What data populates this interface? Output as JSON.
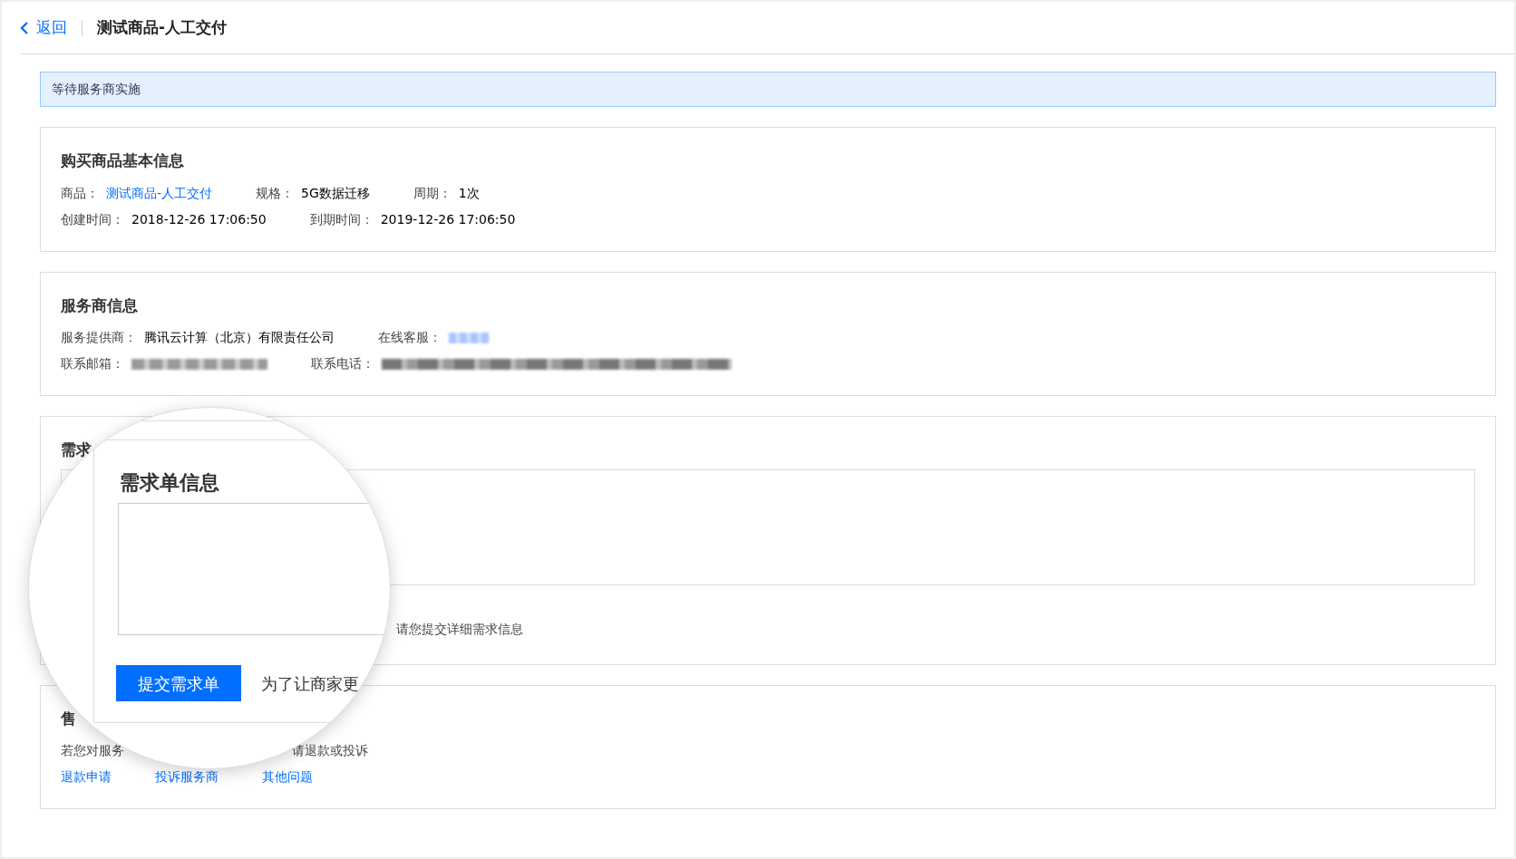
{
  "header": {
    "back_label": "返回",
    "title": "测试商品-人工交付"
  },
  "status_banner": "等待服务商实施",
  "product_info": {
    "title": "购买商品基本信息",
    "rows": [
      [
        {
          "label": "商品：",
          "value": "测试商品-人工交付",
          "kind": "link"
        },
        {
          "label": "规格：",
          "value": "5G数据迁移",
          "kind": "text"
        },
        {
          "label": "周期：",
          "value": "1次",
          "kind": "text"
        }
      ],
      [
        {
          "label": "创建时间：",
          "value": "2018-12-26 17:06:50",
          "kind": "text"
        },
        {
          "label": "到期时间：",
          "value": "2019-12-26 17:06:50",
          "kind": "text"
        }
      ]
    ]
  },
  "provider_info": {
    "title": "服务商信息",
    "rows": [
      [
        {
          "label": "服务提供商：",
          "value": "腾讯云计算（北京）有限责任公司",
          "kind": "text"
        },
        {
          "label": "在线客服：",
          "kind": "redacted_link"
        }
      ],
      [
        {
          "label": "联系邮箱：",
          "kind": "redacted_short"
        },
        {
          "label": "联系电话：",
          "kind": "redacted_long"
        }
      ]
    ]
  },
  "requirement": {
    "title": "需求",
    "hint": "请您提交详细需求信息"
  },
  "after_sales": {
    "title": "售",
    "text_parts": [
      "若您对服务",
      "请退款或投诉"
    ],
    "links": [
      "退款申请",
      "投诉服务商",
      "其他问题"
    ]
  },
  "magnifier": {
    "title": "需求单信息",
    "button": "提交需求单",
    "hint": "为了让商家更"
  }
}
